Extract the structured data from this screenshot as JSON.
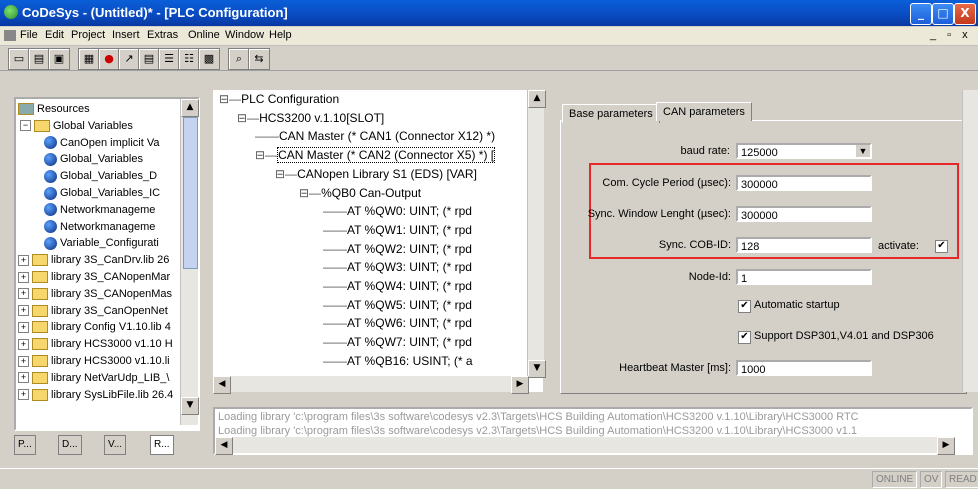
{
  "window": {
    "title": "CoDeSys - (Untitled)* - [PLC Configuration]",
    "min": "_",
    "max": "□",
    "close": "X"
  },
  "menu": [
    "File",
    "Edit",
    "Project",
    "Insert",
    "Extras",
    "Online",
    "Window",
    "Help"
  ],
  "mdi_controls": "_ ▫ x",
  "resources_tree": [
    {
      "label": "Resources",
      "kind": "root"
    },
    {
      "label": "Global Variables",
      "kind": "folder-open"
    },
    {
      "label": "CanOpen implicit Va",
      "kind": "globe"
    },
    {
      "label": "Global_Variables",
      "kind": "globe"
    },
    {
      "label": "Global_Variables_D",
      "kind": "globe"
    },
    {
      "label": "Global_Variables_IC",
      "kind": "globe"
    },
    {
      "label": "Networkmanageme",
      "kind": "globe"
    },
    {
      "label": "Networkmanageme",
      "kind": "globe"
    },
    {
      "label": "Variable_Configurati",
      "kind": "globe"
    },
    {
      "label": "library 3S_CanDrv.lib 26",
      "kind": "folder"
    },
    {
      "label": "library 3S_CANopenMar",
      "kind": "folder"
    },
    {
      "label": "library 3S_CANopenMas",
      "kind": "folder"
    },
    {
      "label": "library 3S_CanOpenNet",
      "kind": "folder"
    },
    {
      "label": "library Config V1.10.lib 4",
      "kind": "folder"
    },
    {
      "label": "library HCS3000 v1.10 H",
      "kind": "folder"
    },
    {
      "label": "library HCS3000 v1.10.li",
      "kind": "folder"
    },
    {
      "label": "library NetVarUdp_LIB_\\",
      "kind": "folder"
    },
    {
      "label": "library SysLibFile.lib 26.4",
      "kind": "folder"
    }
  ],
  "object_tabs": [
    "P...",
    "D...",
    "V...",
    "R..."
  ],
  "plc_config": [
    {
      "label": "PLC Configuration",
      "indent": 0
    },
    {
      "label": "HCS3200 v.1.10[SLOT]",
      "indent": 1
    },
    {
      "label": "CAN Master (* CAN1 (Connector X12) *)",
      "indent": 2
    },
    {
      "label": "CAN Master (* CAN2 (Connector X5) *) [",
      "indent": 2
    },
    {
      "label": "CANopen Library S1 (EDS)  [VAR]",
      "indent": 3
    },
    {
      "label": "%QB0 Can-Output",
      "indent": 4
    },
    {
      "label": "AT %QW0: UINT; (* rpd",
      "indent": 5
    },
    {
      "label": "AT %QW1: UINT; (* rpd",
      "indent": 5
    },
    {
      "label": "AT %QW2: UINT; (* rpd",
      "indent": 5
    },
    {
      "label": "AT %QW3: UINT; (* rpd",
      "indent": 5
    },
    {
      "label": "AT %QW4: UINT; (* rpd",
      "indent": 5
    },
    {
      "label": "AT %QW5: UINT; (* rpd",
      "indent": 5
    },
    {
      "label": "AT %QW6: UINT; (* rpd",
      "indent": 5
    },
    {
      "label": "AT %QW7: UINT; (* rpd",
      "indent": 5
    },
    {
      "label": "AT %QB16: USINT; (* a",
      "indent": 5
    }
  ],
  "tabs": [
    "Base parameters",
    "CAN parameters"
  ],
  "params": {
    "baud_rate_label": "baud rate:",
    "baud_rate_value": "125000",
    "cycle_label": "Com. Cycle Period (µsec):",
    "cycle_value": "300000",
    "sync_window_label": "Sync. Window Lenght (µsec):",
    "sync_window_value": "300000",
    "cobid_label": "Sync. COB-ID:",
    "cobid_value": "128",
    "activate_label": "activate:",
    "nodeid_label": "Node-Id:",
    "nodeid_value": "1",
    "autostart_label": "Automatic startup",
    "support_label": "Support DSP301,V4.01 and DSP306",
    "heartbeat_label": "Heartbeat Master [ms]:",
    "heartbeat_value": "1000"
  },
  "log": [
    "Loading library 'c:\\program files\\3s software\\codesys v2.3\\Targets\\HCS Building Automation\\HCS3200 v.1.10\\Library\\HCS3000 RTC",
    "Loading library 'c:\\program files\\3s software\\codesys v2.3\\Targets\\HCS Building Automation\\HCS3200 v.1.10\\Library\\HCS3000 v1.1"
  ],
  "status": [
    "ONLINE",
    "OV",
    "READ"
  ],
  "accent": "#e8272b"
}
